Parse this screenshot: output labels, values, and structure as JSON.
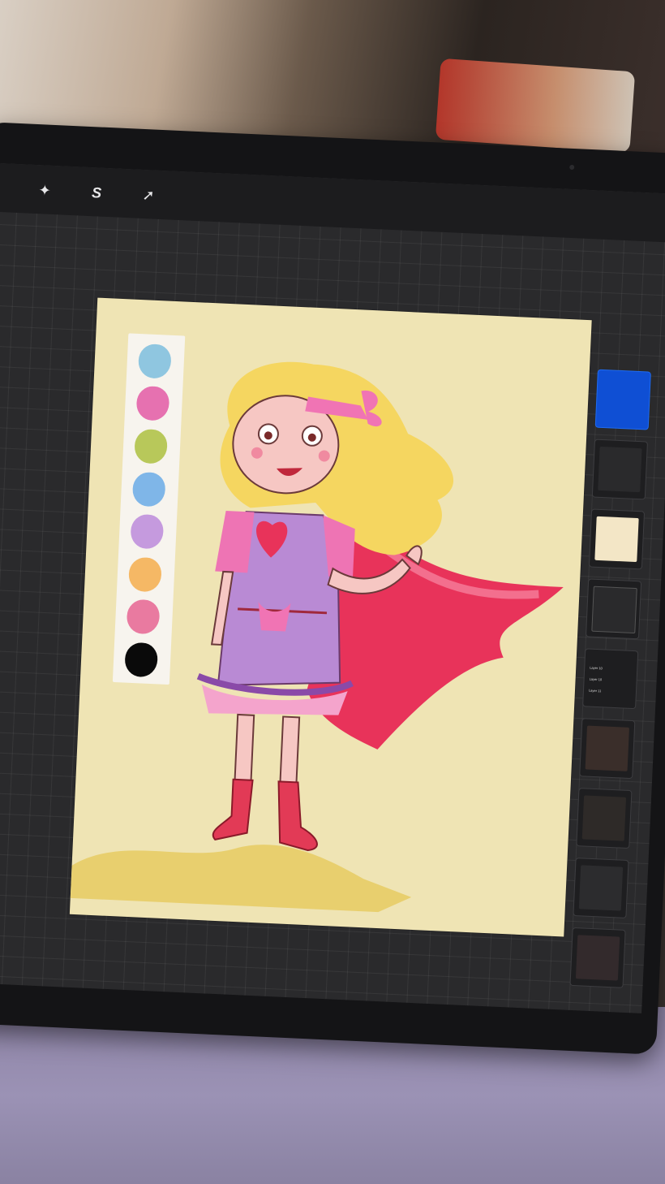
{
  "toolbar": {
    "tools": [
      {
        "name": "adjustments-tool",
        "glyph": "✦"
      },
      {
        "name": "selection-tool",
        "glyph": "S"
      },
      {
        "name": "transform-tool",
        "glyph": "➚"
      }
    ]
  },
  "palette": {
    "swatches": [
      "#8fc6e0",
      "#e671b0",
      "#b8c85a",
      "#7fb6e8",
      "#c59ade",
      "#f5b865",
      "#e97aa0",
      "#0a0a0a"
    ]
  },
  "layers_panel": {
    "group_layer_names": [
      "Layer 10",
      "Layer 10",
      "Layer 11"
    ]
  },
  "colors": {
    "canvas_background": "#efe4b4",
    "selected_layer_accent": "#1f6bf0"
  }
}
